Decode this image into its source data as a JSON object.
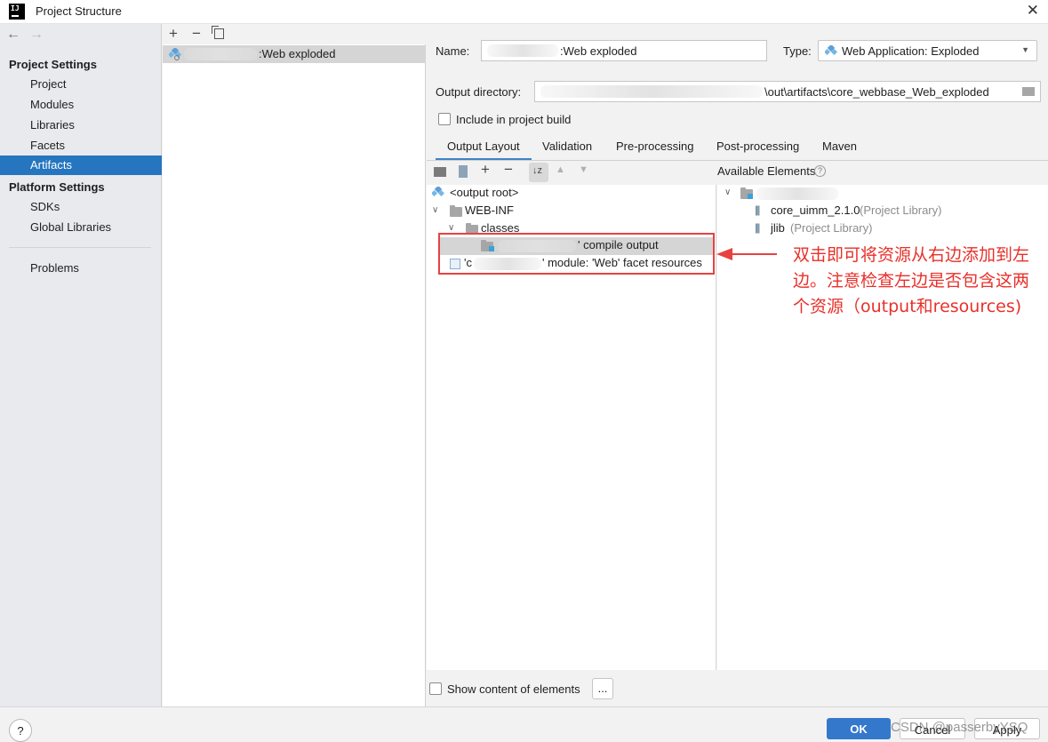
{
  "window": {
    "title": "Project Structure"
  },
  "nav": {
    "project_settings_header": "Project Settings",
    "project_items": [
      {
        "label": "Project"
      },
      {
        "label": "Modules"
      },
      {
        "label": "Libraries"
      },
      {
        "label": "Facets"
      },
      {
        "label": "Artifacts",
        "selected": true
      }
    ],
    "platform_settings_header": "Platform Settings",
    "platform_items": [
      {
        "label": "SDKs"
      },
      {
        "label": "Global Libraries"
      }
    ],
    "problems": "Problems"
  },
  "artifact_list": {
    "items": [
      {
        "label": ":Web exploded",
        "selected": true
      }
    ]
  },
  "form": {
    "name_label": "Name:",
    "name_value": ":Web exploded",
    "type_label": "Type:",
    "type_value": "Web Application: Exploded",
    "output_dir_label": "Output directory:",
    "output_dir_value": "\\out\\artifacts\\core_webbase_Web_exploded",
    "include_build_label": "Include in project build",
    "include_build_checked": false
  },
  "tabs": [
    {
      "label": "Output Layout",
      "active": true
    },
    {
      "label": "Validation"
    },
    {
      "label": "Pre-processing"
    },
    {
      "label": "Post-processing"
    },
    {
      "label": "Maven"
    }
  ],
  "available_elements_label": "Available Elements",
  "layout_tree": {
    "output_root": "<output root>",
    "web_inf": "WEB-INF",
    "classes": "classes",
    "compile_output": "' compile output",
    "facet_resources": "' module: 'Web' facet resources",
    "facet_prefix": "'c"
  },
  "available_tree": {
    "libraries": [
      {
        "name": "core_uimm_2.1.0",
        "kind": "(Project Library)"
      },
      {
        "name": "jlib",
        "kind": "(Project Library)"
      }
    ]
  },
  "annotation": "双击即可将资源从右边添加到左边。注意检查左边是否包含这两个资源（output和resources)",
  "show_content_label": "Show content of elements",
  "ellipsis_button": "...",
  "buttons": {
    "help": "?",
    "ok": "OK",
    "cancel": "Cancel",
    "apply": "Apply"
  },
  "watermark": "CSDN @passerbyYSQ",
  "colors": {
    "selection": "#2675bf",
    "ok_button": "#3478cc",
    "annotation_red": "#e84141"
  }
}
